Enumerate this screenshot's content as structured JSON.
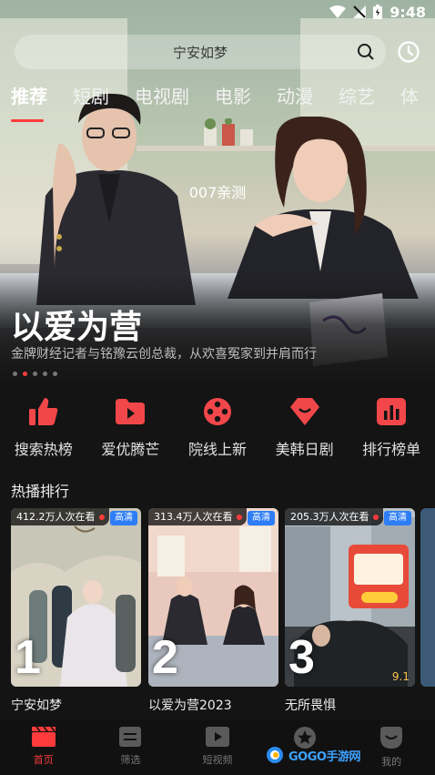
{
  "status_bar": {
    "time": "9:48"
  },
  "search": {
    "placeholder": "宁安如梦"
  },
  "tabs": [
    "推荐",
    "短剧",
    "电视剧",
    "电影",
    "动漫",
    "综艺",
    "体"
  ],
  "hero": {
    "overlay_text": "007亲测",
    "title": "以爱为营",
    "subtitle": "金牌财经记者与铭豫云创总裁，从欢喜冤家到并肩而行"
  },
  "categories": [
    {
      "label": "搜索热榜",
      "icon": "thumbs-up-icon"
    },
    {
      "label": "爱优腾芒",
      "icon": "play-folder-icon"
    },
    {
      "label": "院线上新",
      "icon": "film-reel-icon"
    },
    {
      "label": "美韩日剧",
      "icon": "heart-badge-icon"
    },
    {
      "label": "排行榜单",
      "icon": "bar-chart-icon"
    }
  ],
  "section_title": "热播排行",
  "cards": [
    {
      "viewers": "412.2万人次在看",
      "quality": "高清",
      "rank": "1",
      "title": "宁安如梦"
    },
    {
      "viewers": "313.4万人次在看",
      "quality": "高清",
      "rank": "2",
      "title": "以爱为营2023"
    },
    {
      "viewers": "205.3万人次在看",
      "quality": "高清",
      "rank": "3",
      "title": "无所畏惧",
      "score": "9.1"
    }
  ],
  "bottom_nav": [
    {
      "label": "首页",
      "icon": "clapperboard-icon",
      "active": true
    },
    {
      "label": "筛选",
      "icon": "filter-icon"
    },
    {
      "label": "短视频",
      "icon": "video-icon"
    },
    {
      "label": "",
      "icon": "star-icon"
    },
    {
      "label": "我的",
      "icon": "user-icon"
    }
  ],
  "brand_watermark": "GOGO手游网",
  "colors": {
    "accent": "#ff3b3b",
    "background": "#141414",
    "hd_badge": "#2d7df6"
  }
}
